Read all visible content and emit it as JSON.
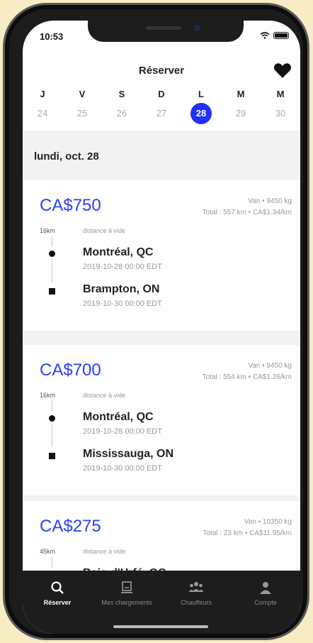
{
  "status": {
    "time": "10:53"
  },
  "header": {
    "title": "Réserver"
  },
  "days": [
    {
      "letter": "J",
      "num": "24"
    },
    {
      "letter": "V",
      "num": "25"
    },
    {
      "letter": "S",
      "num": "26"
    },
    {
      "letter": "D",
      "num": "27"
    },
    {
      "letter": "L",
      "num": "28",
      "selected": true
    },
    {
      "letter": "M",
      "num": "29"
    },
    {
      "letter": "M",
      "num": "30"
    }
  ],
  "date_heading": "lundi, oct. 28",
  "loads": [
    {
      "price": "CA$750",
      "vehicle": "Van • 9450 kg",
      "total": "Total : 557 km • CA$1.34/km",
      "empty_distance": "16km",
      "empty_label": "distance à vide",
      "origin": "Montréal, QC",
      "origin_time": "2019-10-28 00:00 EDT",
      "destination": "Brampton, ON",
      "destination_time": "2019-10-30 00:00 EDT"
    },
    {
      "price": "CA$700",
      "vehicle": "Van • 9450 kg",
      "total": "Total : 554 km • CA$1.26/km",
      "empty_distance": "16km",
      "empty_label": "distance à vide",
      "origin": "Montréal, QC",
      "origin_time": "2019-10-28 00:00 EDT",
      "destination": "Mississauga, ON",
      "destination_time": "2019-10-30 00:00 EDT"
    },
    {
      "price": "CA$275",
      "vehicle": "Van • 10350 kg",
      "total": "Total : 23 km • CA$11.95/km",
      "empty_distance": "45km",
      "empty_label": "distance à vide",
      "origin": "Baie-d'Urfé, QC",
      "origin_time": "",
      "destination": "",
      "destination_time": ""
    }
  ],
  "tabs": [
    {
      "label": "Réserver",
      "icon": "search-icon",
      "active": true
    },
    {
      "label": "Mes chargements",
      "icon": "loads-icon",
      "active": false
    },
    {
      "label": "Chauffeurs",
      "icon": "drivers-icon",
      "active": false
    },
    {
      "label": "Compte",
      "icon": "account-icon",
      "active": false
    }
  ],
  "colors": {
    "accent": "#1f32f5",
    "price": "#2b3ff0",
    "tabbar": "#1d1d1d",
    "background": "#f7ecc4"
  }
}
